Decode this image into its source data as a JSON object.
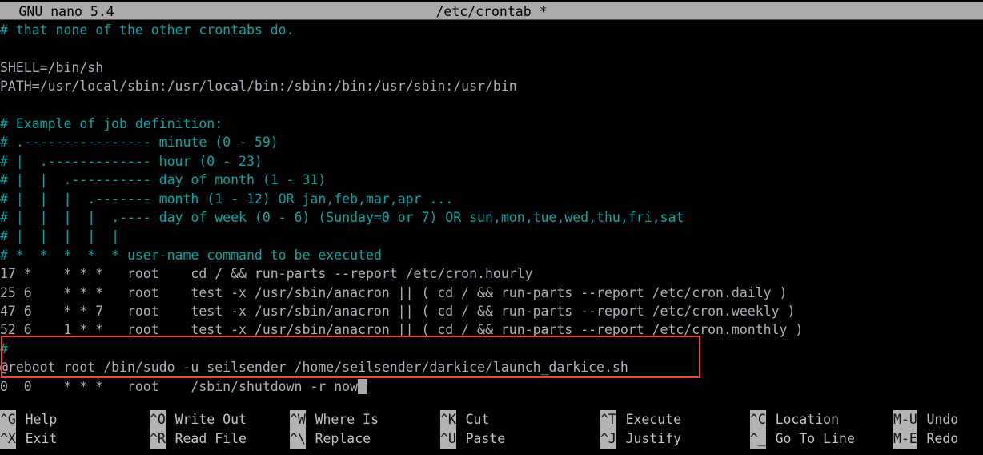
{
  "titlebar": {
    "version": "GNU nano 5.4",
    "filename": "/etc/crontab *"
  },
  "editor": {
    "lines": [
      {
        "text": "# that none of the other crontabs do.",
        "style": "comment"
      },
      {
        "text": "",
        "style": "plain"
      },
      {
        "text": "SHELL=/bin/sh",
        "style": "plain"
      },
      {
        "text": "PATH=/usr/local/sbin:/usr/local/bin:/sbin:/bin:/usr/sbin:/usr/bin",
        "style": "plain"
      },
      {
        "text": "",
        "style": "plain"
      },
      {
        "text": "# Example of job definition:",
        "style": "comment"
      },
      {
        "text": "# .---------------- minute (0 - 59)",
        "style": "comment"
      },
      {
        "text": "# |  .------------- hour (0 - 23)",
        "style": "comment"
      },
      {
        "text": "# |  |  .---------- day of month (1 - 31)",
        "style": "comment"
      },
      {
        "text": "# |  |  |  .------- month (1 - 12) OR jan,feb,mar,apr ...",
        "style": "comment"
      },
      {
        "text": "# |  |  |  |  .---- day of week (0 - 6) (Sunday=0 or 7) OR sun,mon,tue,wed,thu,fri,sat",
        "style": "comment"
      },
      {
        "text": "# |  |  |  |  |",
        "style": "comment"
      },
      {
        "text": "# *  *  *  *  * user-name command to be executed",
        "style": "comment"
      },
      {
        "text": "17 *\t* * *\troot\tcd / && run-parts --report /etc/cron.hourly",
        "style": "plain"
      },
      {
        "text": "25 6\t* * *\troot\ttest -x /usr/sbin/anacron || ( cd / && run-parts --report /etc/cron.daily )",
        "style": "plain"
      },
      {
        "text": "47 6\t* * 7\troot\ttest -x /usr/sbin/anacron || ( cd / && run-parts --report /etc/cron.weekly )",
        "style": "plain"
      },
      {
        "text": "52 6\t1 * *\troot\ttest -x /usr/sbin/anacron || ( cd / && run-parts --report /etc/cron.monthly )",
        "style": "plain"
      },
      {
        "text": "#",
        "style": "comment"
      },
      {
        "text": "@reboot root /bin/sudo -u seilsender /home/seilsender/darkice/launch_darkice.sh",
        "style": "plain"
      },
      {
        "text": "0  0\t* * *\troot\t/sbin/shutdown -r now",
        "style": "plain",
        "cursor": true
      }
    ],
    "highlight_note": "red-box around @reboot and shutdown lines",
    "highlight_color": "#f4442e"
  },
  "shortcuts": {
    "row1": [
      {
        "key": "^G",
        "label": "Help"
      },
      {
        "key": "^O",
        "label": "Write Out"
      },
      {
        "key": "^W",
        "label": "Where Is"
      },
      {
        "key": "^K",
        "label": "Cut"
      },
      {
        "key": "^T",
        "label": "Execute"
      },
      {
        "key": "^C",
        "label": "Location"
      },
      {
        "key": "M-U",
        "label": "Undo"
      }
    ],
    "row2": [
      {
        "key": "^X",
        "label": "Exit"
      },
      {
        "key": "^R",
        "label": "Read File"
      },
      {
        "key": "^\\",
        "label": "Replace"
      },
      {
        "key": "^U",
        "label": "Paste"
      },
      {
        "key": "^J",
        "label": "Justify"
      },
      {
        "key": "^_",
        "label": "Go To Line"
      },
      {
        "key": "M-E",
        "label": "Redo"
      }
    ]
  }
}
